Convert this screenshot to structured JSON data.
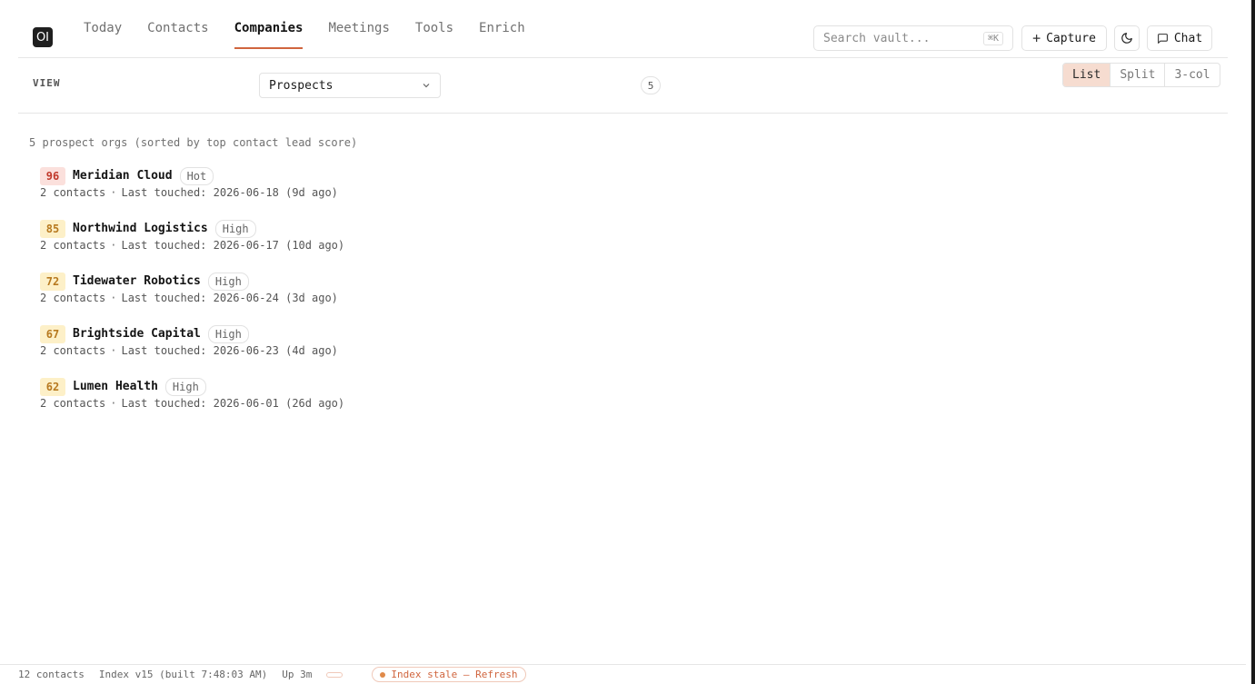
{
  "app": {
    "logo_text": "OI"
  },
  "nav": {
    "tabs": [
      {
        "label": "Today"
      },
      {
        "label": "Contacts"
      },
      {
        "label": "Companies",
        "active": true
      },
      {
        "label": "Meetings"
      },
      {
        "label": "Tools"
      },
      {
        "label": "Enrich"
      }
    ]
  },
  "header": {
    "search_placeholder": "Search vault...",
    "search_shortcut": "⌘K",
    "capture_label": "Capture",
    "chat_label": "Chat",
    "theme_icon": "moon-icon"
  },
  "viewbar": {
    "label": "VIEW",
    "selected_view": "Prospects",
    "count": "5",
    "layout_modes": [
      {
        "label": "List",
        "active": true
      },
      {
        "label": "Split"
      },
      {
        "label": "3-col"
      }
    ]
  },
  "main": {
    "summary": "5 prospect orgs (sorted by top contact lead score)",
    "orgs": [
      {
        "score": "96",
        "name": "Meridian Cloud",
        "tier": "Hot",
        "contacts": "2 contacts",
        "last_touched": "Last touched: 2026-06-18 (9d ago)",
        "level": "hot"
      },
      {
        "score": "85",
        "name": "Northwind Logistics",
        "tier": "High",
        "contacts": "2 contacts",
        "last_touched": "Last touched: 2026-06-17 (10d ago)",
        "level": "high"
      },
      {
        "score": "72",
        "name": "Tidewater Robotics",
        "tier": "High",
        "contacts": "2 contacts",
        "last_touched": "Last touched: 2026-06-24 (3d ago)",
        "level": "high"
      },
      {
        "score": "67",
        "name": "Brightside Capital",
        "tier": "High",
        "contacts": "2 contacts",
        "last_touched": "Last touched: 2026-06-23 (4d ago)",
        "level": "high"
      },
      {
        "score": "62",
        "name": "Lumen Health",
        "tier": "High",
        "contacts": "2 contacts",
        "last_touched": "Last touched: 2026-06-01 (26d ago)",
        "level": "high"
      }
    ]
  },
  "statusbar": {
    "contacts": "12 contacts",
    "index": "Index v15 (built 7:48:03 AM)",
    "uptime": "Up 3m",
    "stale_label": "Index stale — Refresh"
  },
  "colors": {
    "accent": "#d0653e",
    "hot_bg": "#fbe0dc",
    "high_bg": "#fdf0c8",
    "active_layout_bg": "#f6dcd0"
  }
}
